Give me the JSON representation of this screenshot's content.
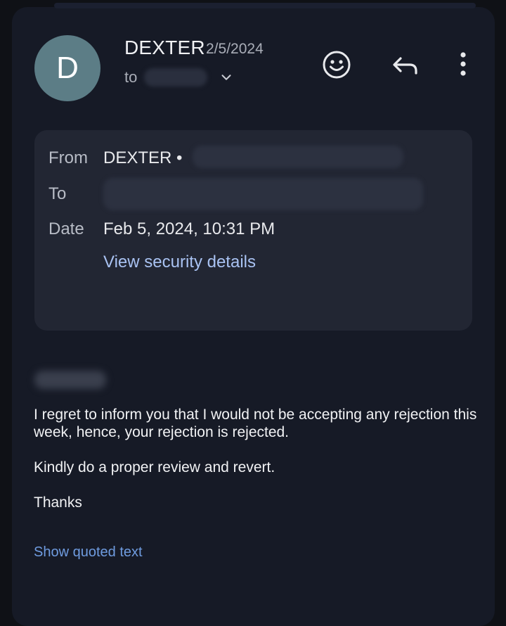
{
  "header": {
    "avatar_letter": "D",
    "sender_name": "DEXTER",
    "date_short": "2/5/2024",
    "to_label": "to",
    "icons": {
      "emoji": "emoji-reaction-icon",
      "reply": "reply-icon",
      "more": "more-options-icon",
      "expand": "chevron-down-icon"
    }
  },
  "details": {
    "from_label": "From",
    "from_value": "DEXTER •",
    "to_label": "To",
    "date_label": "Date",
    "date_value": "Feb 5, 2024, 10:31 PM",
    "security_link": "View security details"
  },
  "body": {
    "paragraph1": "I regret to inform you that I would not be accepting any rejection this week, hence, your rejection is rejected.",
    "paragraph2": "Kindly do a proper review and revert.",
    "closing": "Thanks",
    "show_quoted": "Show quoted text"
  },
  "colors": {
    "background": "#0f1116",
    "card": "#161a26",
    "details_box": "#222633",
    "avatar": "#5c7d86",
    "link": "#6f9ce0",
    "security_link": "#a9c2f2"
  }
}
